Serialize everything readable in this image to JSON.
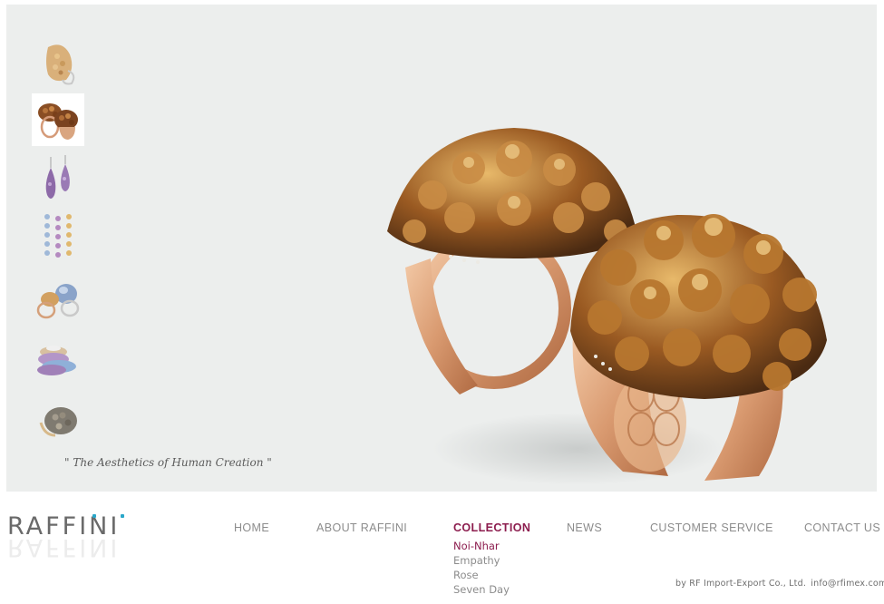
{
  "tagline": "\" The Aesthetics of Human Creation \"",
  "brand": {
    "logo_text": "RAFFINI",
    "accent_color": "#2aa7c9"
  },
  "thumbnails": [
    {
      "name": "thumb-yellow-diamond-ring",
      "active": false
    },
    {
      "name": "thumb-brown-gem-rings",
      "active": true
    },
    {
      "name": "thumb-purple-drop-earrings",
      "active": false
    },
    {
      "name": "thumb-gem-chain-necklaces",
      "active": false
    },
    {
      "name": "thumb-blue-cabochon-rings",
      "active": false
    },
    {
      "name": "thumb-pave-band-rings",
      "active": false
    },
    {
      "name": "thumb-grey-dome-ring",
      "active": false
    }
  ],
  "nav": {
    "home": "HOME",
    "about": "ABOUT RAFFINI",
    "collection": "COLLECTION",
    "news": "NEWS",
    "customer_service": "CUSTOMER SERVICE",
    "contact": "CONTACT US"
  },
  "collection_submenu": [
    "Noi-Nhar",
    "Empathy",
    "Rose",
    "Seven Day"
  ],
  "footer": {
    "credit": "by RF Import-Export Co., Ltd.",
    "email": "info@rfimex.com"
  },
  "colors": {
    "nav_active": "#8c1d4e",
    "nav_text": "#8c8c8c",
    "hero_bg": "#eceeed"
  }
}
